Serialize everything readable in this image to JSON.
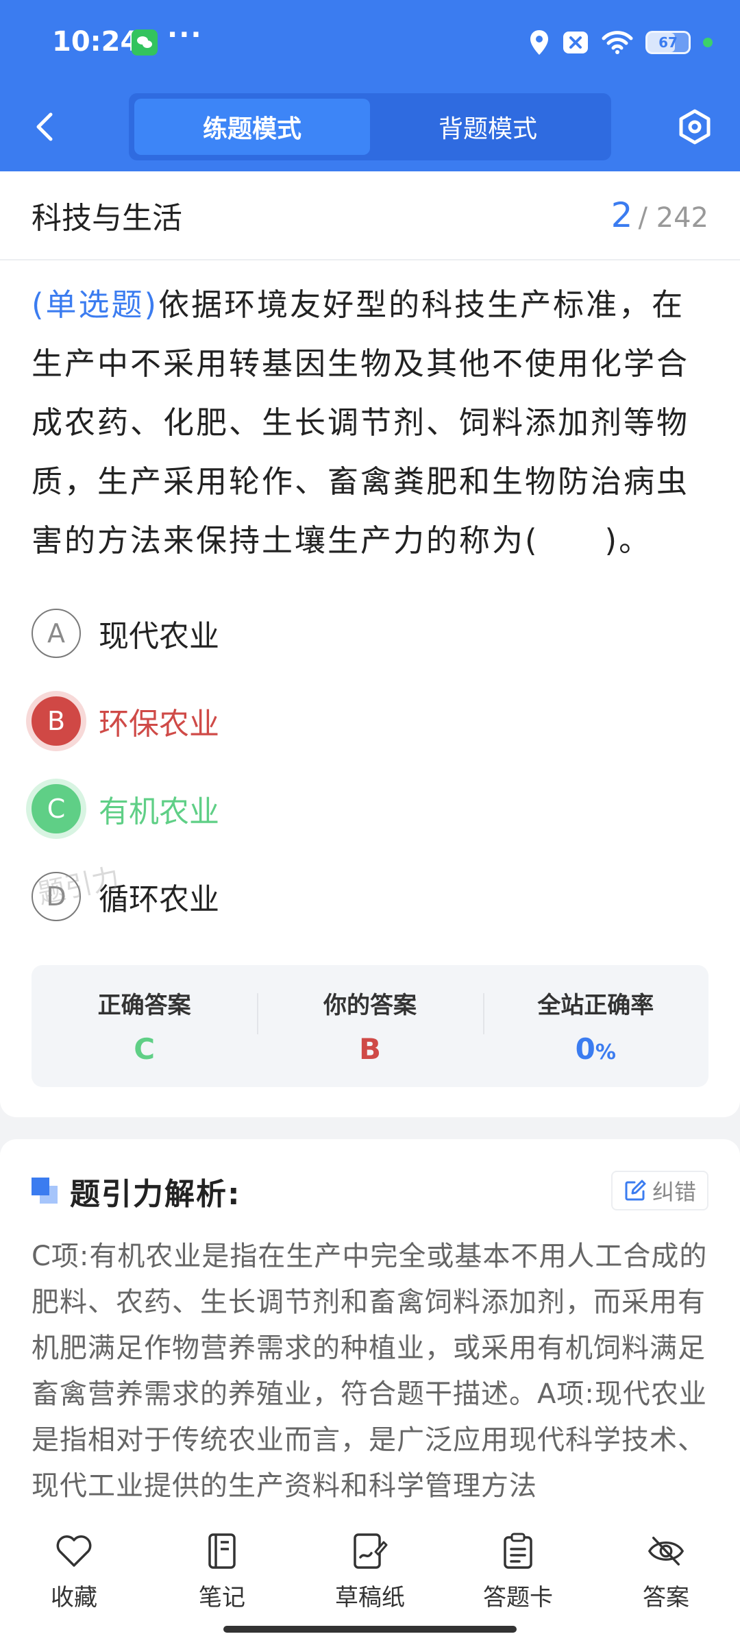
{
  "status_bar": {
    "time": "10:24",
    "more": "···",
    "battery_level": "67",
    "battery_fraction": 0.67
  },
  "header": {
    "tabs": [
      {
        "label": "练题模式",
        "active": true
      },
      {
        "label": "背题模式",
        "active": false
      }
    ],
    "accent_color": "#3b7cf0"
  },
  "question": {
    "category": "科技与生活",
    "index": "2",
    "total": "/ 242",
    "type": "(单选题)",
    "text": "依据环境友好型的科技生产标准，在生产中不采用转基因生物及其他不使用化学合成农药、化肥、生长调节剂、饲料添加剂等物质，生产采用轮作、畜禽粪肥和生物防治病虫害的方法来保持土壤生产力的称为(　　)。",
    "options": [
      {
        "letter": "A",
        "text": "现代农业",
        "state": "normal"
      },
      {
        "letter": "B",
        "text": "环保农业",
        "state": "wrong"
      },
      {
        "letter": "C",
        "text": "有机农业",
        "state": "correct"
      },
      {
        "letter": "D",
        "text": "循环农业",
        "state": "normal"
      }
    ],
    "watermark": "题引力"
  },
  "answer_summary": {
    "correct_label": "正确答案",
    "correct_value": "C",
    "yours_label": "你的答案",
    "yours_value": "B",
    "rate_label": "全站正确率",
    "rate_value": "0",
    "rate_unit": "%"
  },
  "analysis": {
    "title": "题引力解析:",
    "report_label": "纠错",
    "text": "C项:有机农业是指在生产中完全或基本不用人工合成的肥料、农药、生长调节剂和畜禽饲料添加剂，而采用有机肥满足作物营养需求的种植业，或采用有机饲料满足畜禽营养需求的养殖业，符合题干描述。A项:现代农业是指相对于传统农业而言，是广泛应用现代科学技术、现代工业提供的生产资料和科学管理方法"
  },
  "toolbar": {
    "items": [
      {
        "label": "收藏",
        "icon": "heart-icon"
      },
      {
        "label": "笔记",
        "icon": "notebook-icon"
      },
      {
        "label": "草稿纸",
        "icon": "draft-icon"
      },
      {
        "label": "答题卡",
        "icon": "clipboard-icon"
      },
      {
        "label": "答案",
        "icon": "eye-off-icon"
      }
    ]
  }
}
